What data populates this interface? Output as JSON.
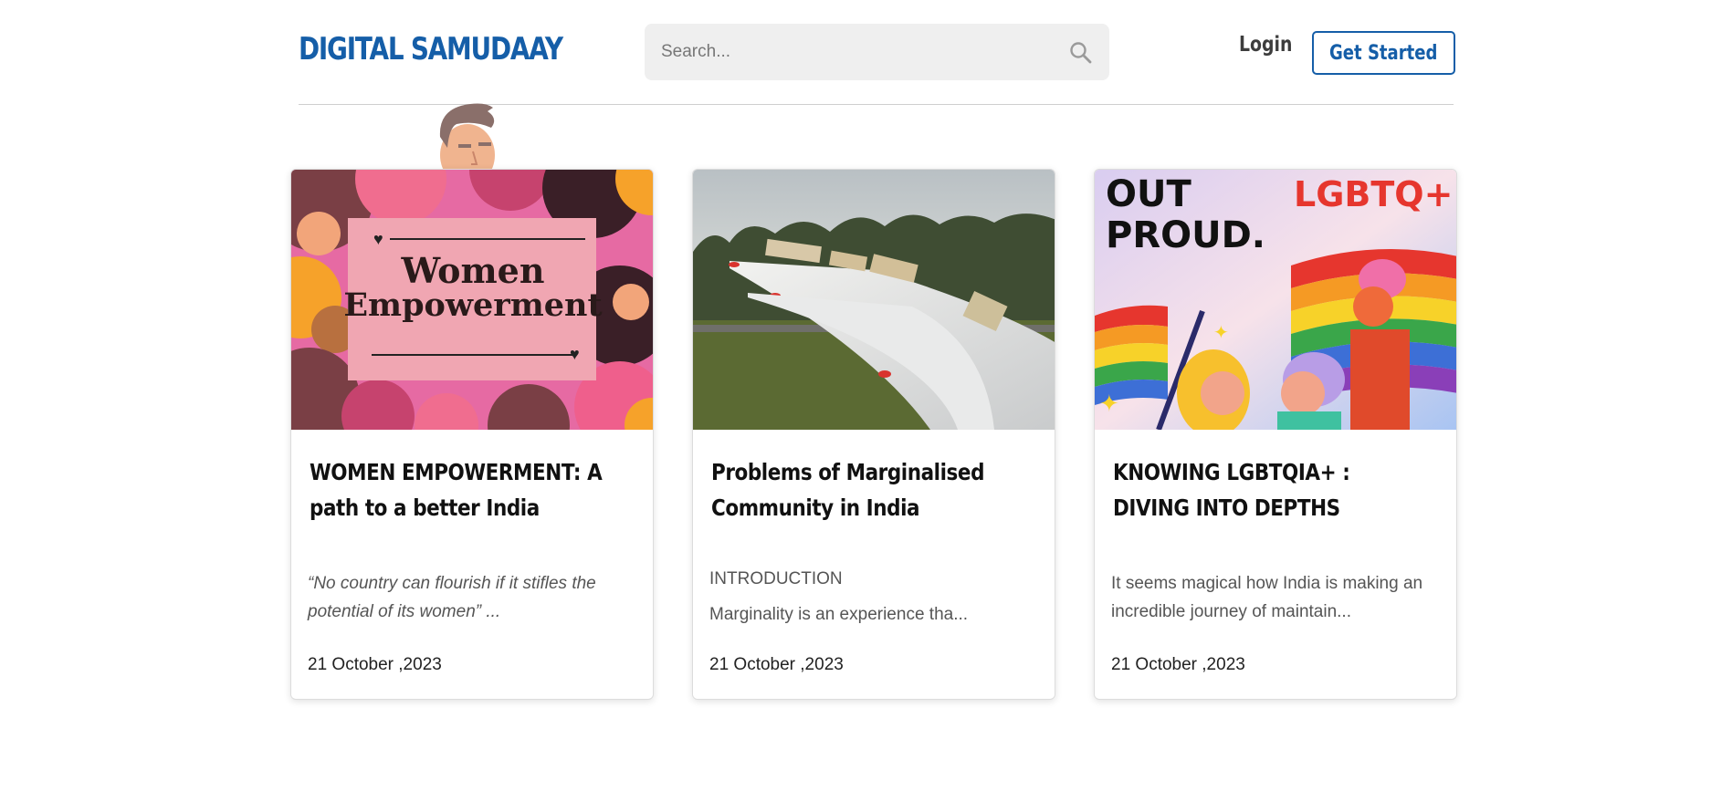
{
  "brand": {
    "logo_text": "DIGITAL SAMUDAAY",
    "accent_color": "#155ea8"
  },
  "search": {
    "placeholder": "Search...",
    "icon": "search-icon"
  },
  "nav": {
    "login_label": "Login",
    "get_started_label": "Get Started"
  },
  "cards": [
    {
      "image_text": {
        "line1": "Women",
        "line2": "Empowerment"
      },
      "title": "WOMEN EMPOWERMENT: A path to a better India",
      "excerpt": "“No country can flourish if it stifles the potential of its women” ...",
      "date": "21 October ,2023"
    },
    {
      "heading": "INTRODUCTION",
      "title": "Problems of Marginalised Community in India",
      "excerpt": "Marginality is an experience tha...",
      "date": "21 October ,2023"
    },
    {
      "image_text": {
        "out_proud": "OUT",
        "out_proud2": "PROUD.",
        "badge": "LGBTQ+"
      },
      "title": "KNOWING LGBTQIA+ : DIVING INTO DEPTHS",
      "excerpt": "It seems magical how India is making an incredible journey of maintain...",
      "date": "21 October ,2023"
    }
  ]
}
